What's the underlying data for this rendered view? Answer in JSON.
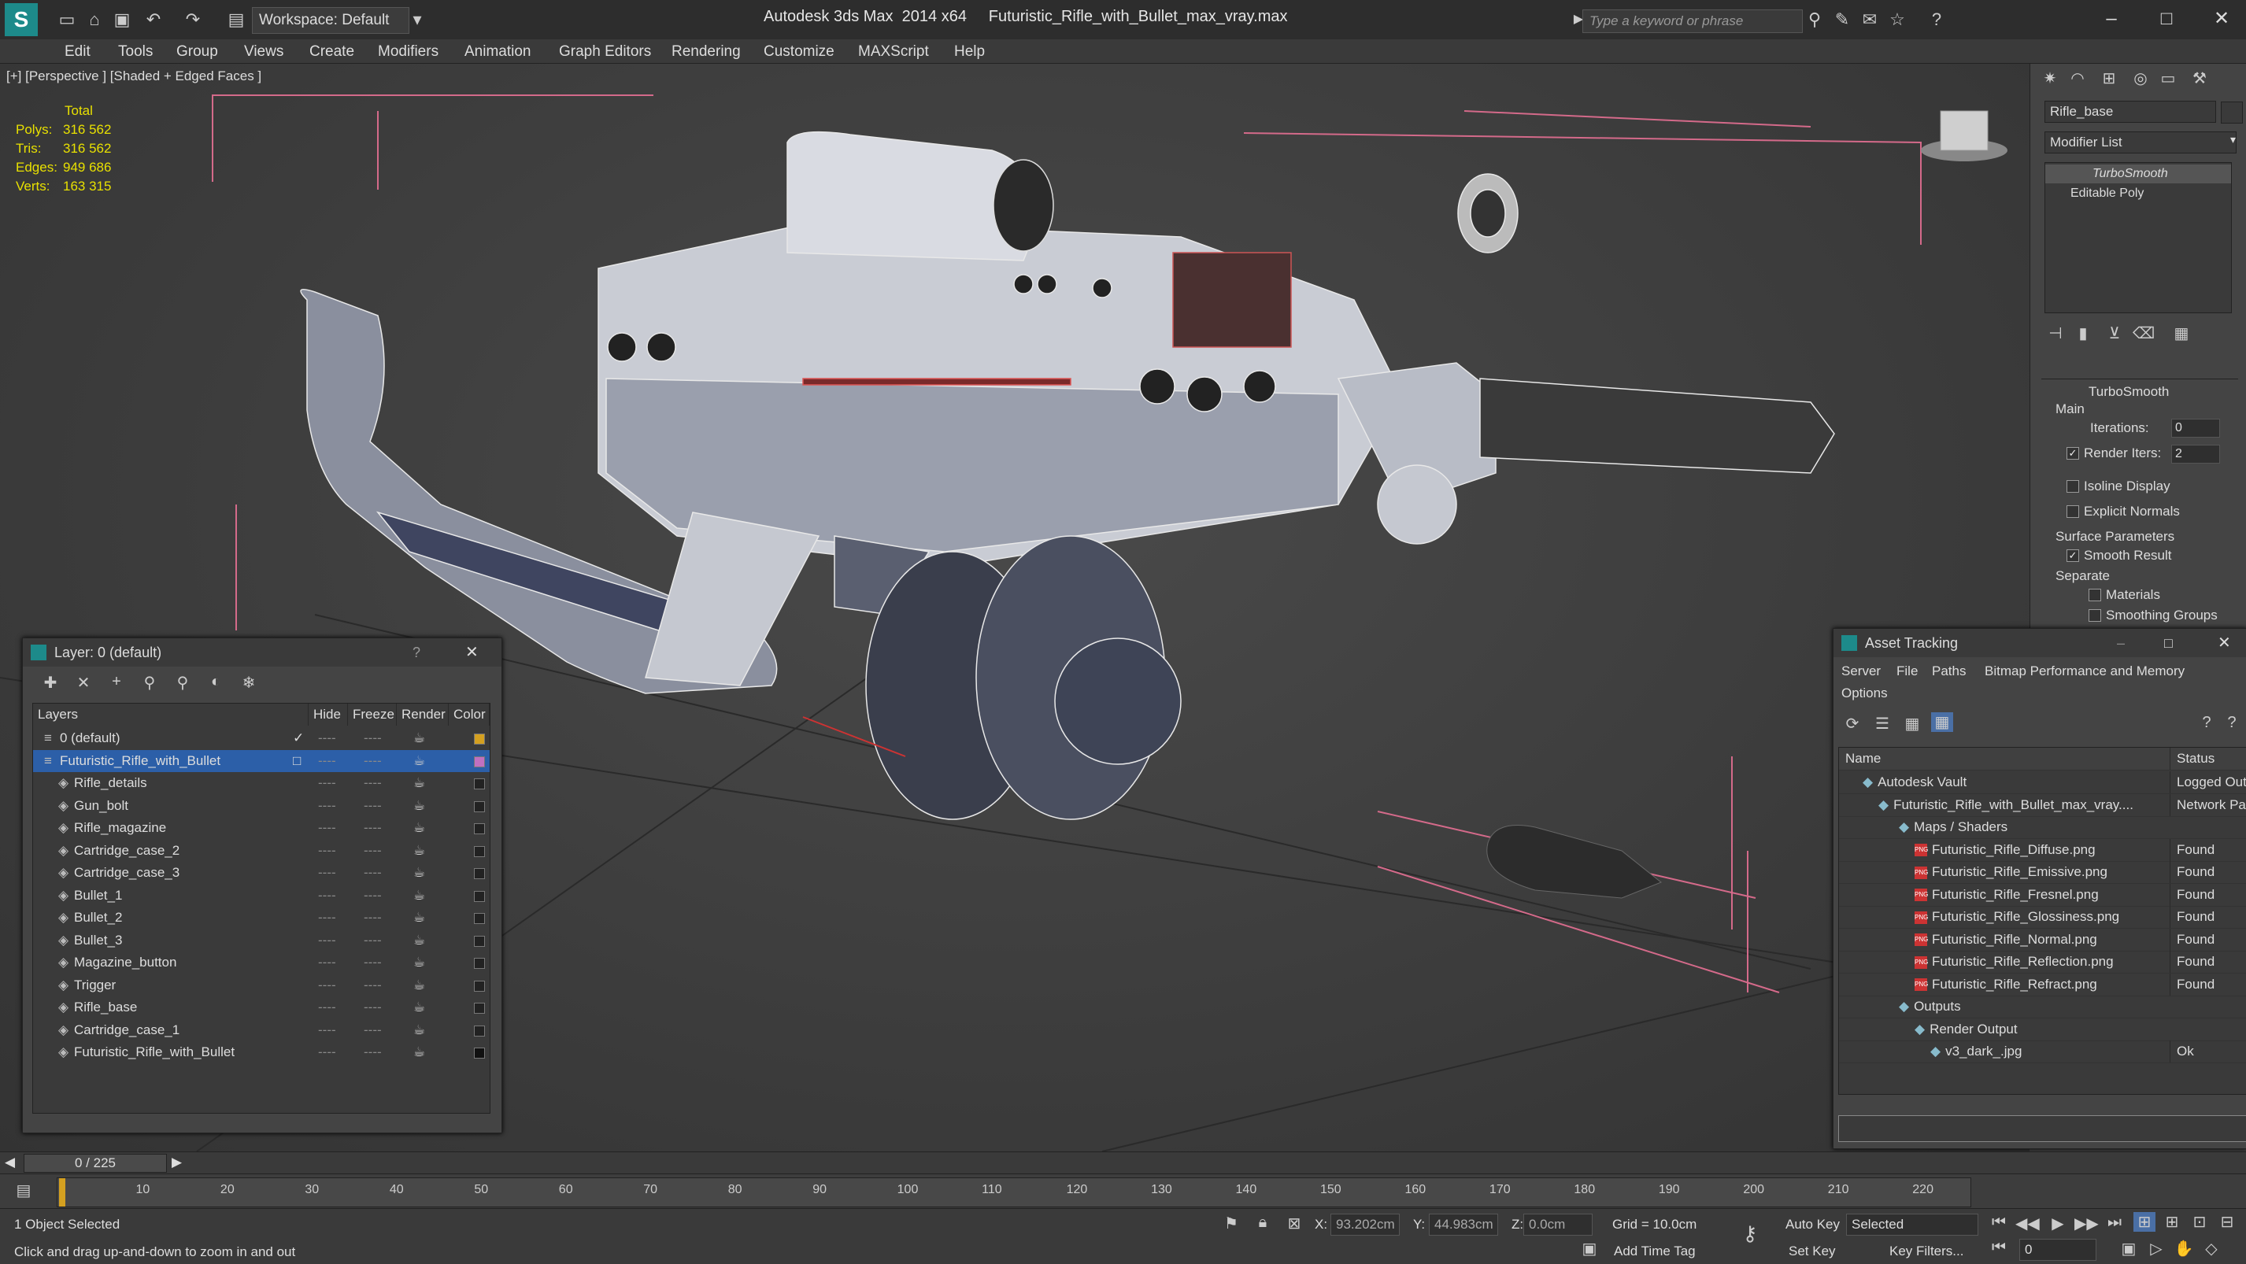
{
  "titlebar": {
    "workspace": "Workspace: Default",
    "app_title": "Autodesk 3ds Max  2014 x64     Futuristic_Rifle_with_Bullet_max_vray.max",
    "search_placeholder": "Type a keyword or phrase"
  },
  "menu": [
    "Edit",
    "Tools",
    "Group",
    "Views",
    "Create",
    "Modifiers",
    "Animation",
    "Graph Editors",
    "Rendering",
    "Customize",
    "MAXScript",
    "Help"
  ],
  "viewport": {
    "label": "[+] [Perspective ] [Shaded + Edged Faces ]",
    "stats": {
      "header": "Total",
      "rows": [
        {
          "k": "Polys:",
          "v": "316 562"
        },
        {
          "k": "Tris:",
          "v": "316 562"
        },
        {
          "k": "Edges:",
          "v": "949 686"
        },
        {
          "k": "Verts:",
          "v": "163 315"
        }
      ]
    }
  },
  "command_panel": {
    "object_name": "Rifle_base",
    "modifier_list": "Modifier List",
    "stack": [
      "TurboSmooth",
      "Editable Poly"
    ],
    "rollout_title": "TurboSmooth",
    "main_label": "Main",
    "iterations_label": "Iterations:",
    "iterations_value": "0",
    "render_iters_label": "Render Iters:",
    "render_iters_value": "2",
    "isoline_label": "Isoline Display",
    "explicit_label": "Explicit Normals",
    "surface_label": "Surface Parameters",
    "smooth_label": "Smooth Result",
    "separate_label": "Separate",
    "materials_label": "Materials",
    "smoothing_label": "Smoothing Groups"
  },
  "layer_window": {
    "title": "Layer: 0 (default)",
    "columns": [
      "Layers",
      "Hide",
      "Freeze",
      "Render",
      "Color"
    ],
    "rows": [
      {
        "name": "0 (default)",
        "color": "#d4a020"
      },
      {
        "name": "Futuristic_Rifle_with_Bullet",
        "color": "#c070c0"
      },
      {
        "name": "Rifle_details",
        "color": "#222222"
      },
      {
        "name": "Gun_bolt",
        "color": "#222222"
      },
      {
        "name": "Rifle_magazine",
        "color": "#222222"
      },
      {
        "name": "Cartridge_case_2",
        "color": "#222222"
      },
      {
        "name": "Cartridge_case_3",
        "color": "#222222"
      },
      {
        "name": "Bullet_1",
        "color": "#222222"
      },
      {
        "name": "Bullet_2",
        "color": "#222222"
      },
      {
        "name": "Bullet_3",
        "color": "#222222"
      },
      {
        "name": "Magazine_button",
        "color": "#222222"
      },
      {
        "name": "Trigger",
        "color": "#222222"
      },
      {
        "name": "Rifle_base",
        "color": "#222222"
      },
      {
        "name": "Cartridge_case_1",
        "color": "#222222"
      },
      {
        "name": "Futuristic_Rifle_with_Bullet",
        "color": "#111111"
      }
    ],
    "dash": "----"
  },
  "asset_window": {
    "title": "Asset Tracking",
    "menu": [
      "Server",
      "File",
      "Paths",
      "Bitmap Performance and Memory"
    ],
    "options": "Options",
    "columns": [
      "Name",
      "Status"
    ],
    "rows": [
      {
        "name": "Autodesk Vault",
        "status": "Logged Out"
      },
      {
        "name": "Futuristic_Rifle_with_Bullet_max_vray....",
        "status": "Network Pat"
      },
      {
        "name": "Maps / Shaders",
        "status": ""
      },
      {
        "name": "Futuristic_Rifle_Diffuse.png",
        "status": "Found"
      },
      {
        "name": "Futuristic_Rifle_Emissive.png",
        "status": "Found"
      },
      {
        "name": "Futuristic_Rifle_Fresnel.png",
        "status": "Found"
      },
      {
        "name": "Futuristic_Rifle_Glossiness.png",
        "status": "Found"
      },
      {
        "name": "Futuristic_Rifle_Normal.png",
        "status": "Found"
      },
      {
        "name": "Futuristic_Rifle_Reflection.png",
        "status": "Found"
      },
      {
        "name": "Futuristic_Rifle_Refract.png",
        "status": "Found"
      },
      {
        "name": "Outputs",
        "status": ""
      },
      {
        "name": "Render Output",
        "status": ""
      },
      {
        "name": "v3_dark_.jpg",
        "status": "Ok"
      }
    ],
    "png_tag": "PNG"
  },
  "timeline": {
    "frame": "0 / 225",
    "ticks": [
      "10",
      "20",
      "30",
      "40",
      "50",
      "60",
      "70",
      "80",
      "90",
      "100",
      "110",
      "120",
      "130",
      "140",
      "150",
      "160",
      "170",
      "180",
      "190",
      "200",
      "210",
      "220"
    ]
  },
  "status": {
    "selected": "1 Object Selected",
    "hint": "Click and drag up-and-down to zoom in and out",
    "x_label": "X:",
    "x_value": "93.202cm",
    "y_label": "Y:",
    "y_value": "44.983cm",
    "z_label": "Z:",
    "z_value": "0.0cm",
    "grid": "Grid = 10.0cm",
    "autokey": "Auto Key",
    "selected_mode": "Selected",
    "setkey": "Set Key",
    "keyfilters": "Key Filters...",
    "add_time_tag": "Add Time Tag",
    "frame_value": "0"
  }
}
